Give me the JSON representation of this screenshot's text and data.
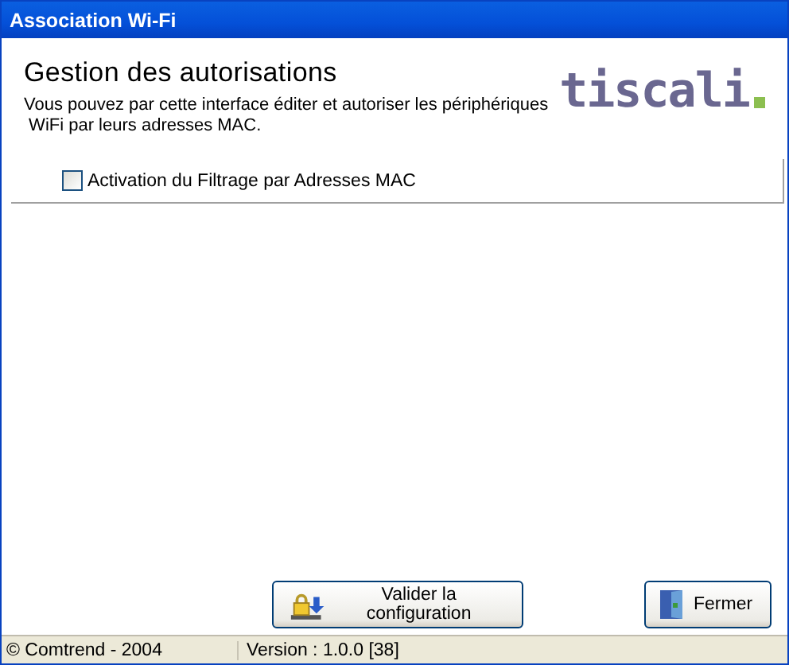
{
  "window": {
    "title": "Association Wi-Fi"
  },
  "header": {
    "title": "Gestion des autorisations",
    "description": "Vous pouvez par cette interface éditer et autoriser les périphériques\n WiFi par leurs adresses MAC.",
    "logo": "tiscali"
  },
  "filter_checkbox": {
    "label": "Activation du Filtrage par Adresses MAC",
    "checked": false
  },
  "buttons": [
    {
      "label": "Valider la configuration",
      "kind": "apply"
    },
    {
      "label": "Fermer",
      "kind": "close"
    }
  ],
  "status_bar": [
    "© Comtrend - 2004",
    "Version :  1.0.0 [38]"
  ]
}
